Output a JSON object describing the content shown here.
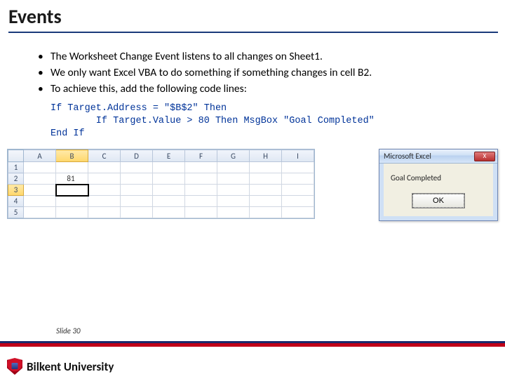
{
  "title": "Events",
  "bullets": [
    "The Worksheet Change Event listens to all changes on Sheet1.",
    "We only want Excel VBA to do something if something changes in cell B2.",
    "To achieve this, add the following code lines:"
  ],
  "code": "If Target.Address = \"$B$2\" Then\n        If Target.Value > 80 Then MsgBox \"Goal Completed\"\nEnd If",
  "excel": {
    "columns": [
      "A",
      "B",
      "C",
      "D",
      "E",
      "F",
      "G",
      "H",
      "I"
    ],
    "rows": [
      "1",
      "2",
      "3",
      "4",
      "5"
    ],
    "selected_col_index": 1,
    "selected_row_index": 2,
    "b2_value": "81"
  },
  "msgbox": {
    "title": "Microsoft Excel",
    "text": "Goal Completed",
    "ok": "OK",
    "close": "X"
  },
  "slide_label": "Slide 30",
  "university": "Bilkent University"
}
